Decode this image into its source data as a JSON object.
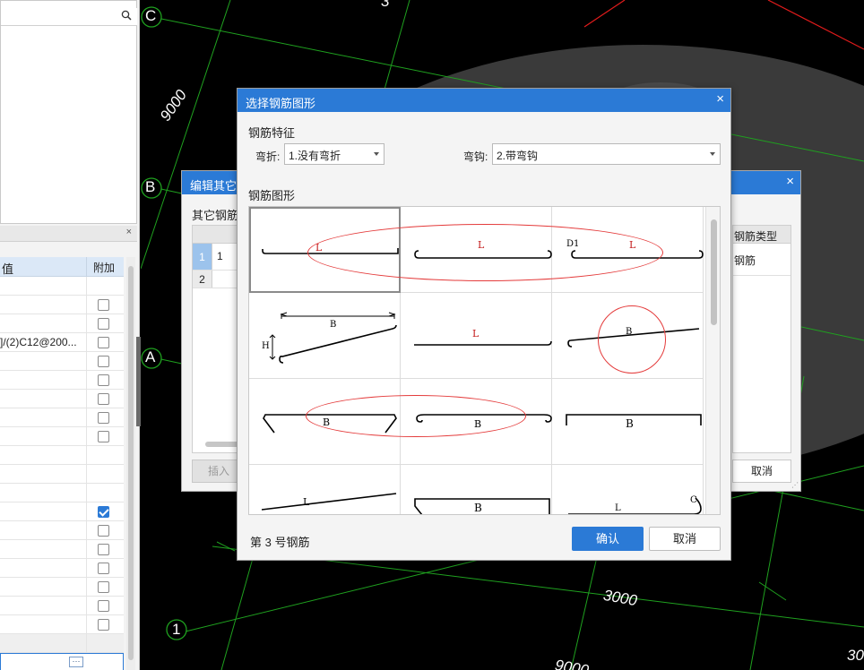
{
  "colors": {
    "accent": "#2b7ad6",
    "grid_line": "#1fa11f",
    "red_line": "#e01b1b",
    "annotation": "#e43b3b",
    "viewport_bg": "#000000"
  },
  "left_panel": {
    "search_icon": "search-icon",
    "prop_close": "×",
    "prop_columns": {
      "value": "值",
      "extra": "附加"
    },
    "prop_rows": [
      {
        "value": "",
        "checkbox": "none",
        "sep": false
      },
      {
        "value": "",
        "checkbox": "unchecked",
        "sep": false
      },
      {
        "value": "",
        "checkbox": "unchecked",
        "sep": false
      },
      {
        "value": "]/(2)C12@200...",
        "checkbox": "unchecked",
        "sep": false
      },
      {
        "value": "",
        "checkbox": "unchecked",
        "sep": false
      },
      {
        "value": "",
        "checkbox": "unchecked",
        "sep": false
      },
      {
        "value": "",
        "checkbox": "unchecked",
        "sep": false
      },
      {
        "value": "",
        "checkbox": "unchecked",
        "sep": false
      },
      {
        "value": "",
        "checkbox": "unchecked",
        "sep": false
      },
      {
        "value": "",
        "checkbox": "none",
        "sep": false
      },
      {
        "value": "",
        "checkbox": "none",
        "sep": false
      },
      {
        "value": "",
        "checkbox": "none",
        "sep": false
      },
      {
        "value": "",
        "checkbox": "checked",
        "sep": false
      },
      {
        "value": "",
        "checkbox": "unchecked",
        "sep": false
      },
      {
        "value": "",
        "checkbox": "unchecked",
        "sep": false
      },
      {
        "value": "",
        "checkbox": "unchecked",
        "sep": false
      },
      {
        "value": "",
        "checkbox": "unchecked",
        "sep": false
      },
      {
        "value": "",
        "checkbox": "unchecked",
        "sep": false
      },
      {
        "value": "",
        "checkbox": "unchecked",
        "sep": false
      },
      {
        "value": "",
        "checkbox": "none",
        "sep": true
      }
    ],
    "ellipsis": "···"
  },
  "viewport": {
    "axis_labels": {
      "c": "C",
      "b": "B",
      "a": "A",
      "one": "1"
    },
    "dims": {
      "d9000_left": "9000",
      "d3000_bottom": "3000",
      "d9000_bottom": "9000",
      "d30_right": "30",
      "d3_top": "3"
    }
  },
  "back_dialog": {
    "title": "编辑其它钢筋",
    "sub_label": "其它钢筋",
    "close": "×",
    "rows": [
      {
        "num": "1",
        "val": "1"
      },
      {
        "num": "2",
        "val": ""
      }
    ],
    "right_header": "钢筋类型",
    "right_cell": "钢筋",
    "insert_button": "插入",
    "cancel_button": "取消"
  },
  "front_dialog": {
    "title": "选择钢筋图形",
    "close": "×",
    "feature_section": "钢筋特征",
    "bend_label": "弯折:",
    "bend_value": "1.没有弯折",
    "hook_label": "弯钩:",
    "hook_value": "2.带弯钩",
    "shape_section": "钢筋图形",
    "shape_labels": {
      "L": "L",
      "B": "B",
      "H": "H",
      "D1": "D1",
      "C": "C"
    },
    "status": "第 3 号钢筋",
    "ok_button": "确认",
    "cancel_button": "取消",
    "selected_shape_index": 0
  }
}
